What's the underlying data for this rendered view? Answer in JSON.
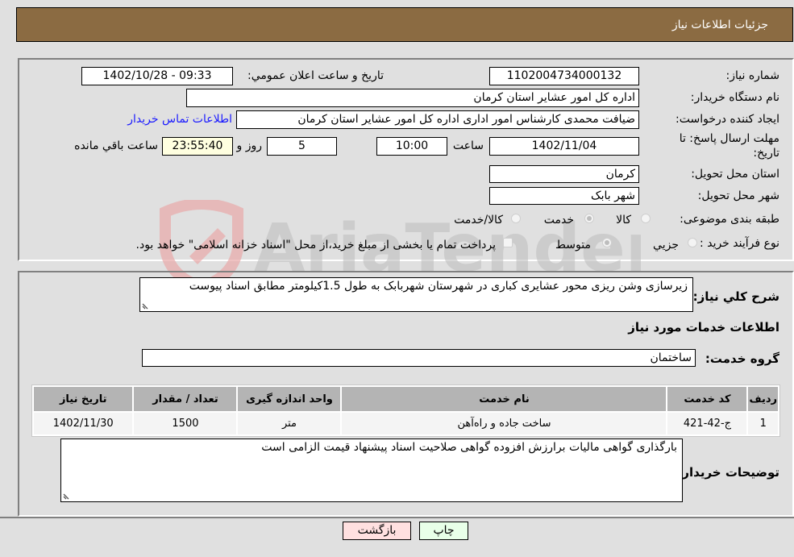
{
  "header": {
    "title": "جزئیات اطلاعات نیاز"
  },
  "form": {
    "need_number": {
      "label": "شماره نیاز:",
      "value": "1102004734000132"
    },
    "announce": {
      "label": "تاریخ و ساعت اعلان عمومي:",
      "value": "1402/10/28 - 09:33"
    },
    "buyer_org": {
      "label": "نام دستگاه خریدار:",
      "value": "اداره کل امور عشایر استان کرمان"
    },
    "requester": {
      "label": "ایجاد کننده درخواست:",
      "value": "ضیافت محمدی کارشناس امور اداری اداره کل امور عشایر استان کرمان"
    },
    "contact_link": "اطلاعات تماس خریدار",
    "deadline": {
      "label_line1": "مهلت ارسال پاسخ: تا",
      "label_line2": "تاریخ:",
      "date": "1402/11/04",
      "time_label": "ساعت",
      "time": "10:00",
      "days": "5",
      "days_label": "روز و",
      "remaining": "23:55:40",
      "remaining_label": "ساعت باقي مانده"
    },
    "province": {
      "label": "استان محل تحویل:",
      "value": "کرمان"
    },
    "city": {
      "label": "شهر محل تحویل:",
      "value": "شهر بابک"
    },
    "category": {
      "label": "طبقه بندی موضوعی:",
      "options": [
        {
          "label": "کالا",
          "checked": false
        },
        {
          "label": "خدمت",
          "checked": true
        },
        {
          "label": "کالا/خدمت",
          "checked": false
        }
      ]
    },
    "process": {
      "label": "نوع فرآیند خرید :",
      "options": [
        {
          "label": "جزيي",
          "checked": false
        },
        {
          "label": "متوسط",
          "checked": true
        }
      ],
      "treasury_checkbox": {
        "label": "پرداخت تمام یا بخشی از مبلغ خرید،از محل \"اسناد خزانه اسلامی\" خواهد بود.",
        "checked": false
      }
    }
  },
  "details": {
    "description": {
      "label": "شرح کلي نیاز:",
      "value": "زیرسازی وشن ریزی محور عشایری کباری در شهرستان شهربابک به طول 1.5کیلومتر مطابق اسناد پیوست"
    },
    "services_heading": "اطلاعات خدمات مورد نیاز",
    "service_group": {
      "label": "گروه خدمت:",
      "value": "ساختمان"
    },
    "table": {
      "columns": [
        "ردیف",
        "کد خدمت",
        "نام خدمت",
        "واحد اندازه گیری",
        "تعداد / مقدار",
        "تاریخ نیاز"
      ],
      "rows": [
        [
          "1",
          "ج-42-421",
          "ساخت جاده و راه‌آهن",
          "متر",
          "1500",
          "1402/11/30"
        ]
      ]
    },
    "buyer_notes": {
      "label": "توضیحات خریدار:",
      "value": "بارگذاری گواهی مالیات برارزش افزوده گواهی صلاحیت اسناد پیشنهاد قیمت الزامی است"
    }
  },
  "buttons": {
    "print": "چاپ",
    "back": "بازگشت"
  },
  "watermark": {
    "text": "AriaTender.neT"
  }
}
